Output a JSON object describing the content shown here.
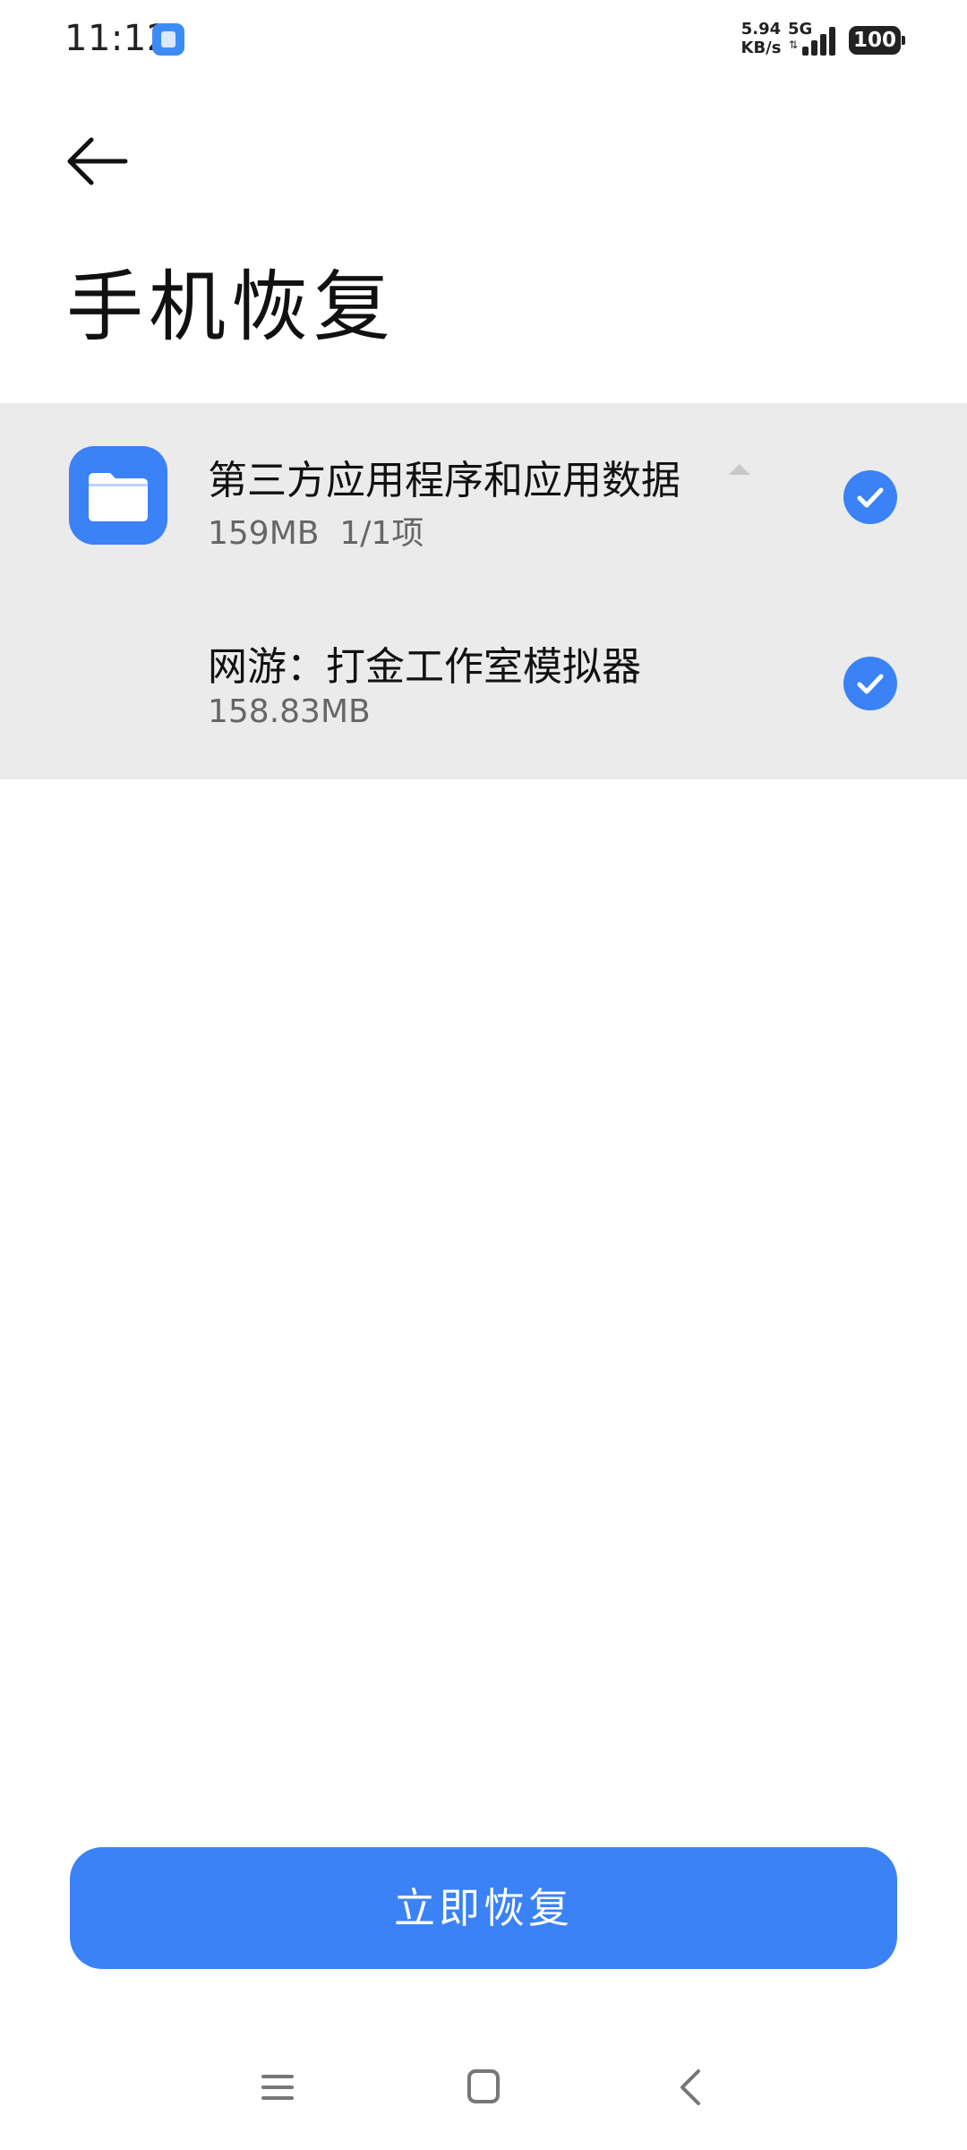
{
  "status_bar": {
    "time": "11:12",
    "net_speed_value": "5.94",
    "net_speed_unit": "KB/s",
    "network_type": "5G",
    "battery": "100",
    "notification_icon": "app-notification-icon",
    "signal_icon": "signal-bars-icon"
  },
  "header": {
    "back_icon": "arrow-left-icon",
    "title": "手机恢复"
  },
  "list": {
    "items": [
      {
        "title": "第三方应用程序和应用数据",
        "size": "159MB",
        "count": "1/1项",
        "icon": "folder-icon",
        "expanded": true,
        "checked": true
      },
      {
        "title": "网游：打金工作室模拟器",
        "size": "158.83MB",
        "checked": true
      }
    ]
  },
  "actions": {
    "restore_label": "立即恢复"
  },
  "nav_bar": {
    "menu_icon": "menu-icon",
    "home_icon": "home-icon",
    "back_icon": "chevron-left-icon"
  },
  "colors": {
    "accent": "#3a82f6",
    "list_background": "#ebebeb",
    "secondary_text": "#666666"
  }
}
